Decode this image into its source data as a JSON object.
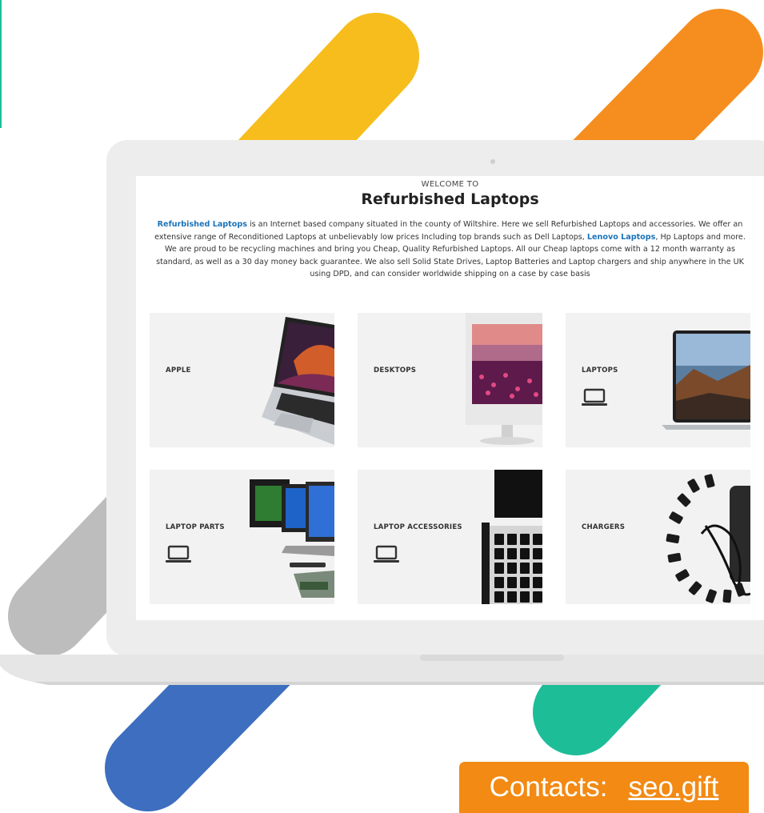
{
  "header": {
    "welcome": "WELCOME TO",
    "title": "Refurbished Laptops"
  },
  "intro": {
    "link_1": "Refurbished Laptops",
    "text_1": " is an Internet based company situated in the county of Wiltshire. Here we sell Refurbished Laptops and accessories. We offer an extensive range of Reconditioned Laptops at unbelievably low prices Including top brands such as Dell Laptops, ",
    "link_2": "Lenovo Laptops",
    "text_2": ", Hp Laptops and more. We are proud to be recycling machines and bring you Cheap, Quality Refurbished Laptops. All our Cheap laptops come with a 12 month warranty as standard, as well as a 30 day money back guarantee. We also sell Solid State Drives, Laptop Batteries and Laptop chargers and ship anywhere in the UK using DPD, and can consider worldwide shipping on a case by case basis"
  },
  "categories": [
    {
      "label": "APPLE",
      "icon": "none",
      "image": "macbook-image"
    },
    {
      "label": "DESKTOPS",
      "icon": "none",
      "image": "desktop-monitor-image"
    },
    {
      "label": "LAPTOPS",
      "icon": "laptop-icon",
      "image": "laptop-image"
    },
    {
      "label": "LAPTOP PARTS",
      "icon": "laptop-icon",
      "image": "laptop-parts-image"
    },
    {
      "label": "LAPTOP ACCESSORIES",
      "icon": "laptop-icon",
      "image": "keyboard-image"
    },
    {
      "label": "CHARGERS",
      "icon": "none",
      "image": "charger-tips-image"
    }
  ],
  "contact": {
    "label": "Contacts:",
    "link": "seo.gift"
  },
  "colors": {
    "link_blue": "#1a73b9",
    "tile_bg": "#f2f2f2",
    "stripe_yellow": "#f6bd1d",
    "stripe_orange": "#f58e1f",
    "stripe_blue": "#3e6ebf",
    "stripe_green": "#1dbd98",
    "stripe_gray": "#bdbdbd",
    "contact_orange": "#f28a14"
  }
}
